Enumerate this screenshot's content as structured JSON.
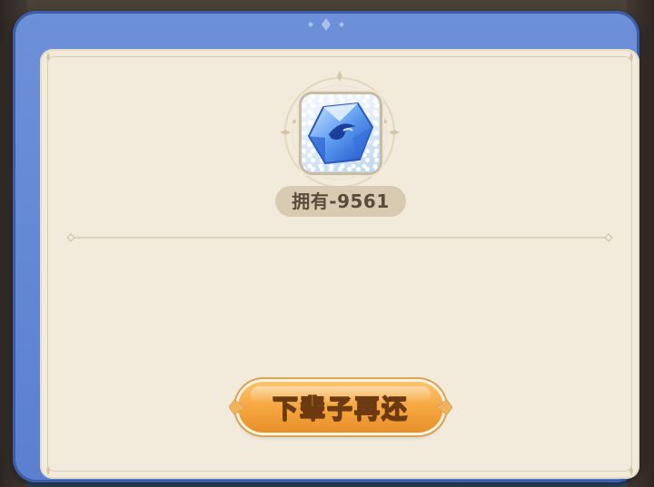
{
  "item": {
    "icon": "blue-crystal-gem-icon",
    "owned_label": "拥有-9561"
  },
  "actions": {
    "confirm_label": "下辈子再还"
  },
  "colors": {
    "frame_blue": "#6d90d8",
    "panel_cream": "#f2ebdc",
    "button_orange": "#f4a43e",
    "pill_tan": "#d9cbb2"
  }
}
